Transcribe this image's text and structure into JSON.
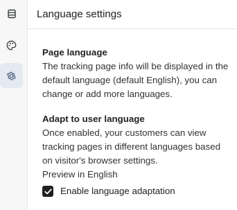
{
  "rail": {
    "items": [
      {
        "icon": "list-icon"
      },
      {
        "icon": "palette-icon"
      },
      {
        "icon": "gear-icon",
        "active": true
      }
    ],
    "active_color": "#5a6b85"
  },
  "header": {
    "title": "Language settings"
  },
  "page_language": {
    "title": "Page language",
    "text": "The tracking page info will be displayed in the default language (default English), you can change or add more languages."
  },
  "adapt": {
    "title": "Adapt to user language",
    "text": "Once enabled, your customers can view tracking pages in different languages based on visitor's browser settings.",
    "preview": "Preview in English",
    "checkbox_label": "Enable language adaptation",
    "checked": true
  }
}
